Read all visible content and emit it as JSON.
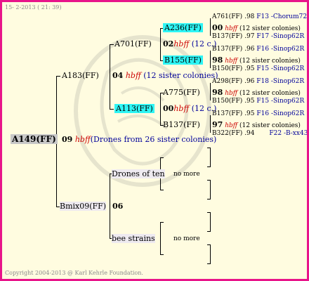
{
  "header": {
    "date": "15- 2-2013 ( 21: 39)"
  },
  "footer": {
    "copyright": "Copyright 2004-2013 @ Karl Kehrle Foundation."
  },
  "watermark_icon": "bee-watermark-icon",
  "colors": {
    "frame": "#e8148a",
    "background": "#fffce0",
    "highlight": "#2ef5f5",
    "hbff": "#cc0000",
    "origin": "#00009a"
  },
  "root": {
    "id": "A149(FF)",
    "gen": "09",
    "hbff": "hbff",
    "note": "(Drones from 26 sister colonies)"
  },
  "dam": {
    "id": "A183(FF)",
    "gen": "04",
    "hbff": "hbff",
    "note": "(12 sister colonies)",
    "upper": {
      "id": "A701(FF)",
      "gen": "02",
      "hbff": "hbff",
      "note": "(12 c.)",
      "upper_leaf": {
        "id": "A236(FF)",
        "gen": "00",
        "hbff": "hbff",
        "note": "(12 sister colonies)",
        "top": {
          "id": "A761(FF)",
          "year": ".98",
          "origin": "F13 -Chorum72R"
        },
        "bottom": {
          "id": "B137(FF)",
          "year": ".97",
          "origin": "F17 -Sinop62R"
        }
      },
      "lower_leaf": {
        "id": "B155(FF)",
        "gen": "98",
        "hbff": "hbff",
        "note": "(12 sister colonies)",
        "top": {
          "id": "B137(FF)",
          "year": ".96",
          "origin": "F16 -Sinop62R"
        },
        "bottom": {
          "id": "B150(FF)",
          "year": ".95",
          "origin": "F15 -Sinop62R"
        }
      }
    },
    "lower": {
      "id": "A113(FF)",
      "gen": "00",
      "hbff": "hbff",
      "note": "(12 c.)",
      "upper_leaf": {
        "id": "A775(FF)",
        "gen": "98",
        "hbff": "hbff",
        "note": "(12 sister colonies)",
        "top": {
          "id": "A298(FF)",
          "year": ".96",
          "origin": "F18 -Sinop62R"
        },
        "bottom": {
          "id": "B150(FF)",
          "year": ".95",
          "origin": "F15 -Sinop62R"
        }
      },
      "lower_leaf": {
        "id": "B137(FF)",
        "gen": "97",
        "hbff": "hbff",
        "note": "(12 sister colonies)",
        "top": {
          "id": "B137(FF)",
          "year": ".95",
          "origin": "F16 -Sinop62R"
        },
        "bottom": {
          "id": "B322(FF)",
          "year": ".94",
          "origin": "F22 -B-xx43"
        }
      }
    }
  },
  "sire": {
    "id": "Bmix09(FF)",
    "gen": "06",
    "upper": {
      "label": "Drones of ten",
      "more": "no more"
    },
    "lower": {
      "label": "bee strains",
      "more": "no more"
    }
  }
}
